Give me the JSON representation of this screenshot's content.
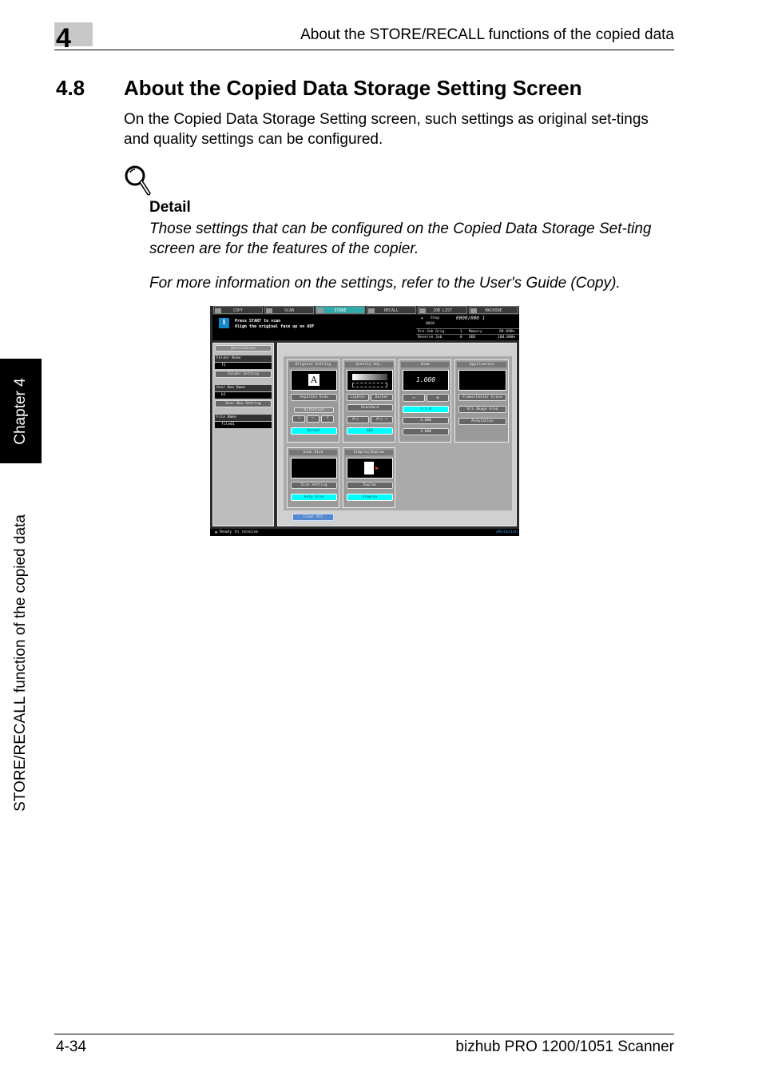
{
  "header": {
    "chapter_number": "4",
    "running_title": "About the STORE/RECALL functions of the copied data"
  },
  "section": {
    "number": "4.8",
    "title": "About the Copied Data Storage Setting Screen",
    "intro": "On the Copied Data Storage Setting screen, such settings as original set-tings and quality settings can be configured."
  },
  "detail": {
    "icon": "magnifier-icon",
    "heading": "Detail",
    "text1": "Those settings that can be configured on the Copied Data Storage Set-ting screen are for the features of the copier.",
    "text2": "For more information on the settings, refer to the User's Guide (Copy)."
  },
  "side": {
    "chapter_label": "Chapter 4",
    "section_label": "STORE/RECALL function of the copied data"
  },
  "footer": {
    "page": "4-34",
    "product": "bizhub PRO 1200/1051 Scanner"
  },
  "screen": {
    "tabs": [
      "COPY",
      "SCAN",
      "STORE",
      "RECALL",
      "JOB LIST",
      "MACHINE"
    ],
    "active_tab": "STORE",
    "message_line1": "Press START to scan",
    "message_line2": "Align the original face up on ADF",
    "status": {
      "stop": "Stop",
      "counter": "0000/000 1",
      "job_number": "0010",
      "prejob_label": "Pre-Job Orig.",
      "prejob_value": "1",
      "memory_label": "Memory",
      "memory_value": "99.998%",
      "reserve_label": "Reserve Job",
      "reserve_value": "0",
      "hdd_label": "HDD",
      "hdd_value": "100.000%"
    },
    "destination": "Destination",
    "folder_name_label": "Folder Name",
    "folder_name_value": "f1",
    "folder_setting": "Folder Setting",
    "user_box_label": "User Box Name",
    "user_box_value": "b1",
    "user_box_setting": "User Box Setting",
    "file_name_label": "File Name",
    "file_name_value": "file01",
    "groups": {
      "original_setting": "Original Setting",
      "separate_scan": "Separate Scan",
      "direction": "Direction",
      "normal": "Normal",
      "quality_adj": "Quality Adj.",
      "lighter": "Lighter",
      "darker": "Darker",
      "standard": "Standard",
      "pri_minus": "Pri -",
      "pri_plus": "Pri +",
      "aes": "AES",
      "zoom": "Zoom",
      "zoom_value": "1.000",
      "zoom_minus": "−",
      "zoom_plus": "+",
      "zoom_preset1": "1:1.0",
      "zoom_preset2": "4.000",
      "zoom_preset3": "2.000",
      "application": "Application",
      "frame_center_erase": "Frame/Center Erase",
      "all_image_area": "All-Image Area",
      "annotation": "Annotation",
      "scan_size": "Scan Size",
      "size_setting": "Size Setting",
      "auto_size": "Auto Size",
      "simplex_duplex": "Simplex/Duplex",
      "duplex": "Duplex",
      "simplex": "Simplex"
    },
    "clear_all": "Clear All",
    "ready": "Ready to receive",
    "rotation": "Rotation"
  }
}
